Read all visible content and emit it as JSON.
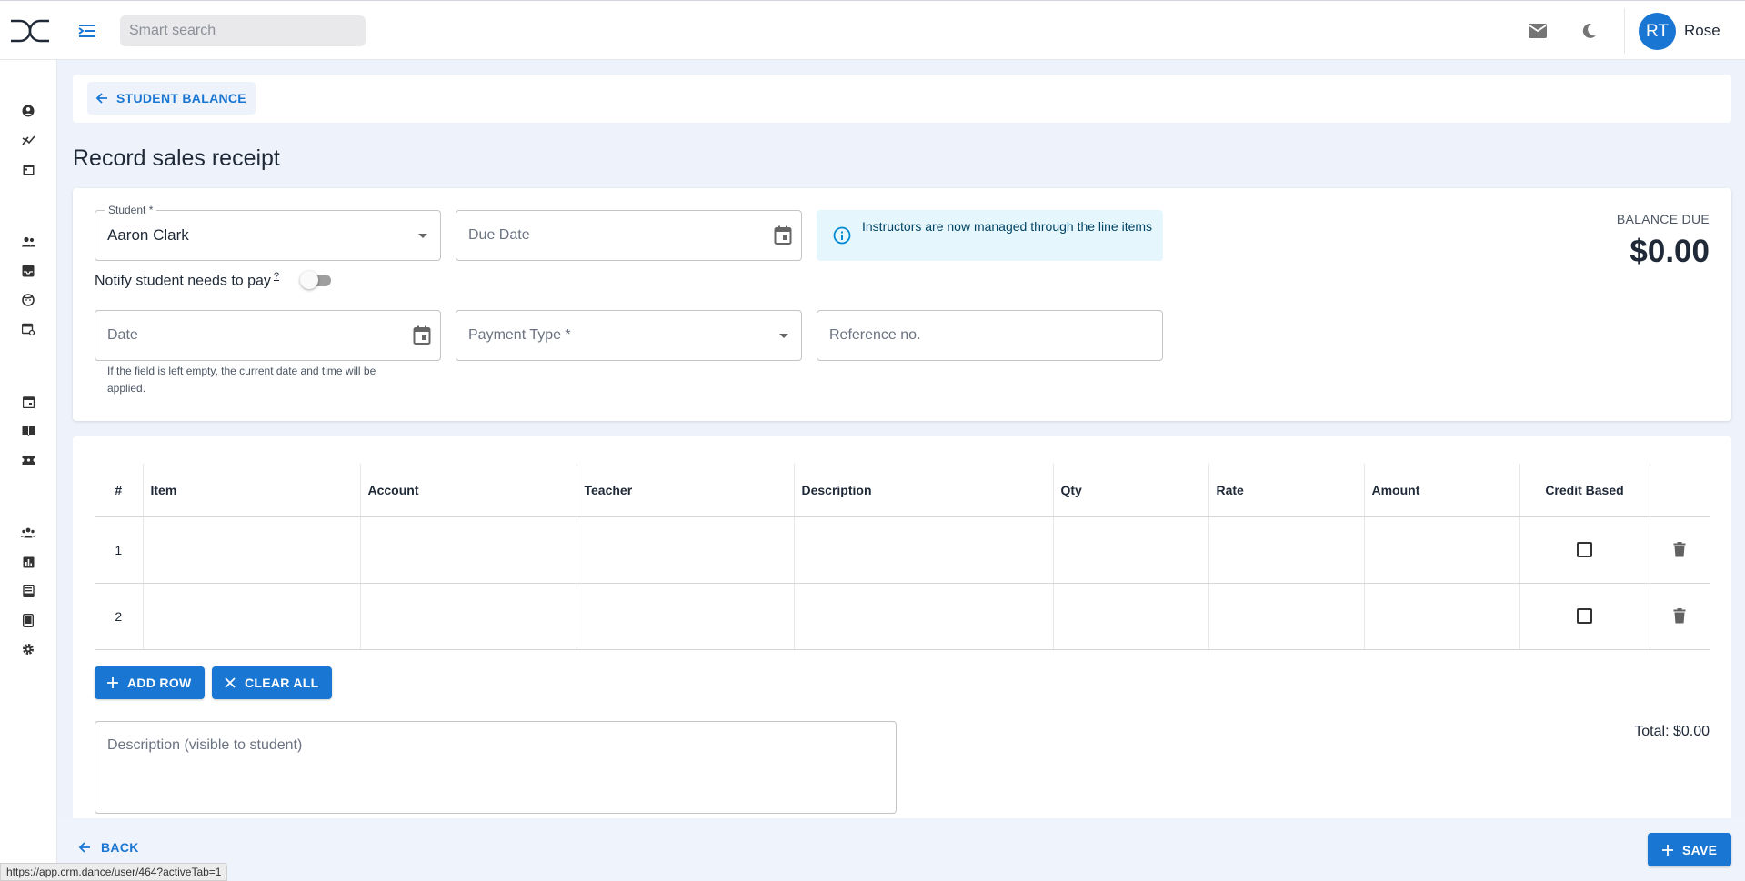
{
  "header": {
    "search_placeholder": "Smart search",
    "user": {
      "initials": "RT",
      "name": "Rose"
    },
    "icons": [
      "menu-toggle-icon",
      "mail-icon",
      "dark-mode-icon"
    ]
  },
  "sidebar": {
    "items": [
      "user-circle-icon",
      "analytics-icon",
      "calendar-icon",
      "people-icon",
      "inbox-icon",
      "face-icon",
      "event-repeat-icon",
      "event-icon",
      "book-icon",
      "ticket-icon",
      "groups-icon",
      "bar-chart-icon",
      "receipt-icon",
      "tablet-icon",
      "settings-icon"
    ]
  },
  "breadcrumb": {
    "back_label": "STUDENT BALANCE"
  },
  "page": {
    "title": "Record sales receipt"
  },
  "form": {
    "student": {
      "label": "Student *",
      "value": "Aaron Clark"
    },
    "due_date": {
      "placeholder": "Due Date"
    },
    "info": "Instructors are now managed through the line items",
    "notify": {
      "label": "Notify student needs to pay",
      "help_mark": "?"
    },
    "date": {
      "placeholder": "Date",
      "helper": "If the field is left empty, the current date and time will be applied."
    },
    "payment_type": {
      "placeholder": "Payment Type *"
    },
    "reference": {
      "placeholder": "Reference no."
    },
    "balance_due": {
      "label": "BALANCE DUE",
      "value": "$0.00"
    }
  },
  "items_table": {
    "columns": [
      "#",
      "Item",
      "Account",
      "Teacher",
      "Description",
      "Qty",
      "Rate",
      "Amount",
      "Credit Based"
    ],
    "rows": [
      {
        "num": "1",
        "item": "",
        "account": "",
        "teacher": "",
        "description": "",
        "qty": "",
        "rate": "",
        "amount": "",
        "credit_based": false
      },
      {
        "num": "2",
        "item": "",
        "account": "",
        "teacher": "",
        "description": "",
        "qty": "",
        "rate": "",
        "amount": "",
        "credit_based": false
      }
    ]
  },
  "actions": {
    "add_row": "ADD ROW",
    "clear_all": "CLEAR ALL",
    "description_placeholder": "Description (visible to student)",
    "total": "Total: $0.00"
  },
  "footer": {
    "back_label": "BACK",
    "save_label": "SAVE"
  },
  "status_url": "https://app.crm.dance/user/464?activeTab=1",
  "colors": {
    "primary": "#1976d2",
    "info_bg": "#e5f6fd",
    "page_bg": "#eef3fb"
  }
}
